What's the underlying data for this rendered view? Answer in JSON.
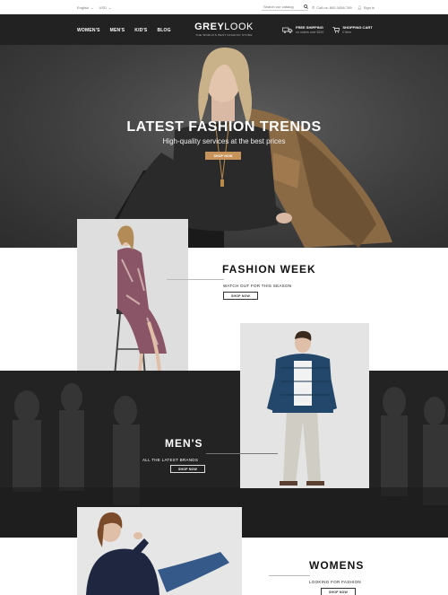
{
  "topbar": {
    "language": "English",
    "currency": "USD",
    "search_placeholder": "Search our catalog",
    "phone": "Call us: 800-3456-789",
    "signin": "Sign In"
  },
  "header": {
    "nav": [
      "WOMEN'S",
      "MEN'S",
      "KID'S",
      "BLOG"
    ],
    "logo_grey": "GREY",
    "logo_look": "LOOK",
    "tagline": "THE WORLD'S BEST FASHION STORE",
    "shipping_title": "FREE SHIPPING",
    "shipping_sub": "on orders over $100",
    "cart_title": "SHOPPING CART",
    "cart_sub": "0 item"
  },
  "hero": {
    "title": "LATEST FASHION TRENDS",
    "subtitle": "High-quality services at the best prices",
    "button": "SHOP NOW"
  },
  "fashion_week": {
    "title": "FASHION WEEK",
    "subtitle": "WATCH OUT FOR THIS SEASON",
    "button": "SHOP NOW"
  },
  "mens": {
    "title": "MEN'S",
    "subtitle": "ALL THE LATEST BRANDS",
    "button": "SHOP NOW"
  },
  "womens": {
    "title": "WOMENS",
    "subtitle": "LOOKING FOR FASHION",
    "button": "SHOP NOW"
  },
  "colors": {
    "header_bg": "#222222",
    "accent": "#c8935a"
  }
}
